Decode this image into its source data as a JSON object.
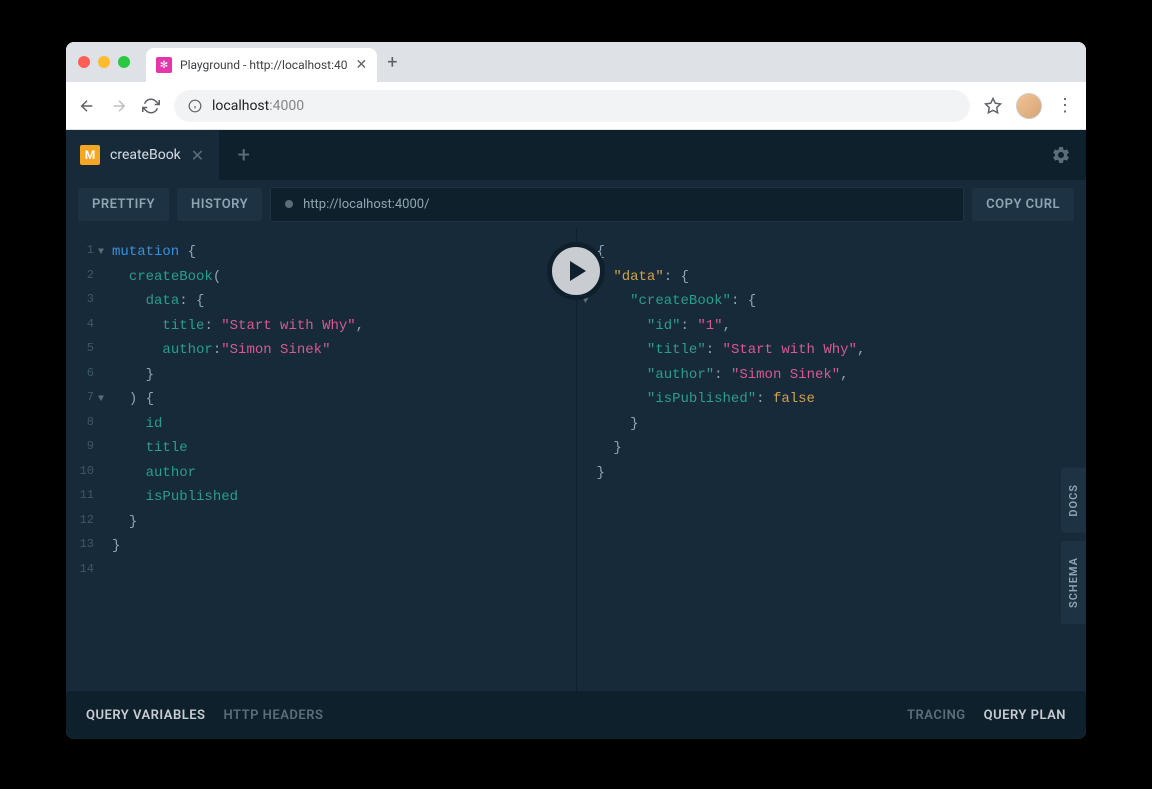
{
  "browser": {
    "tab_title": "Playground - http://localhost:40",
    "url_host": "localhost",
    "url_port": ":4000"
  },
  "playground": {
    "tab_badge": "M",
    "tab_name": "createBook",
    "toolbar": {
      "prettify": "PRETTIFY",
      "history": "HISTORY",
      "url": "http://localhost:4000/",
      "copy_curl": "COPY CURL"
    },
    "side": {
      "docs": "DOCS",
      "schema": "SCHEMA"
    },
    "footer": {
      "query_variables": "QUERY VARIABLES",
      "http_headers": "HTTP HEADERS",
      "tracing": "TRACING",
      "query_plan": "QUERY PLAN"
    },
    "query": {
      "keyword": "mutation",
      "operation": "createBook",
      "arg_name": "data",
      "fields": {
        "title_key": "title",
        "title_val": "\"Start with Why\"",
        "author_key": "author",
        "author_val": "\"Simon Sinek\""
      },
      "selections": [
        "id",
        "title",
        "author",
        "isPublished"
      ]
    },
    "result": {
      "data_key": "\"data\"",
      "createBook_key": "\"createBook\"",
      "id_key": "\"id\"",
      "id_val": "\"1\"",
      "title_key": "\"title\"",
      "title_val": "\"Start with Why\"",
      "author_key": "\"author\"",
      "author_val": "\"Simon Sinek\"",
      "isPublished_key": "\"isPublished\"",
      "isPublished_val": "false"
    }
  }
}
